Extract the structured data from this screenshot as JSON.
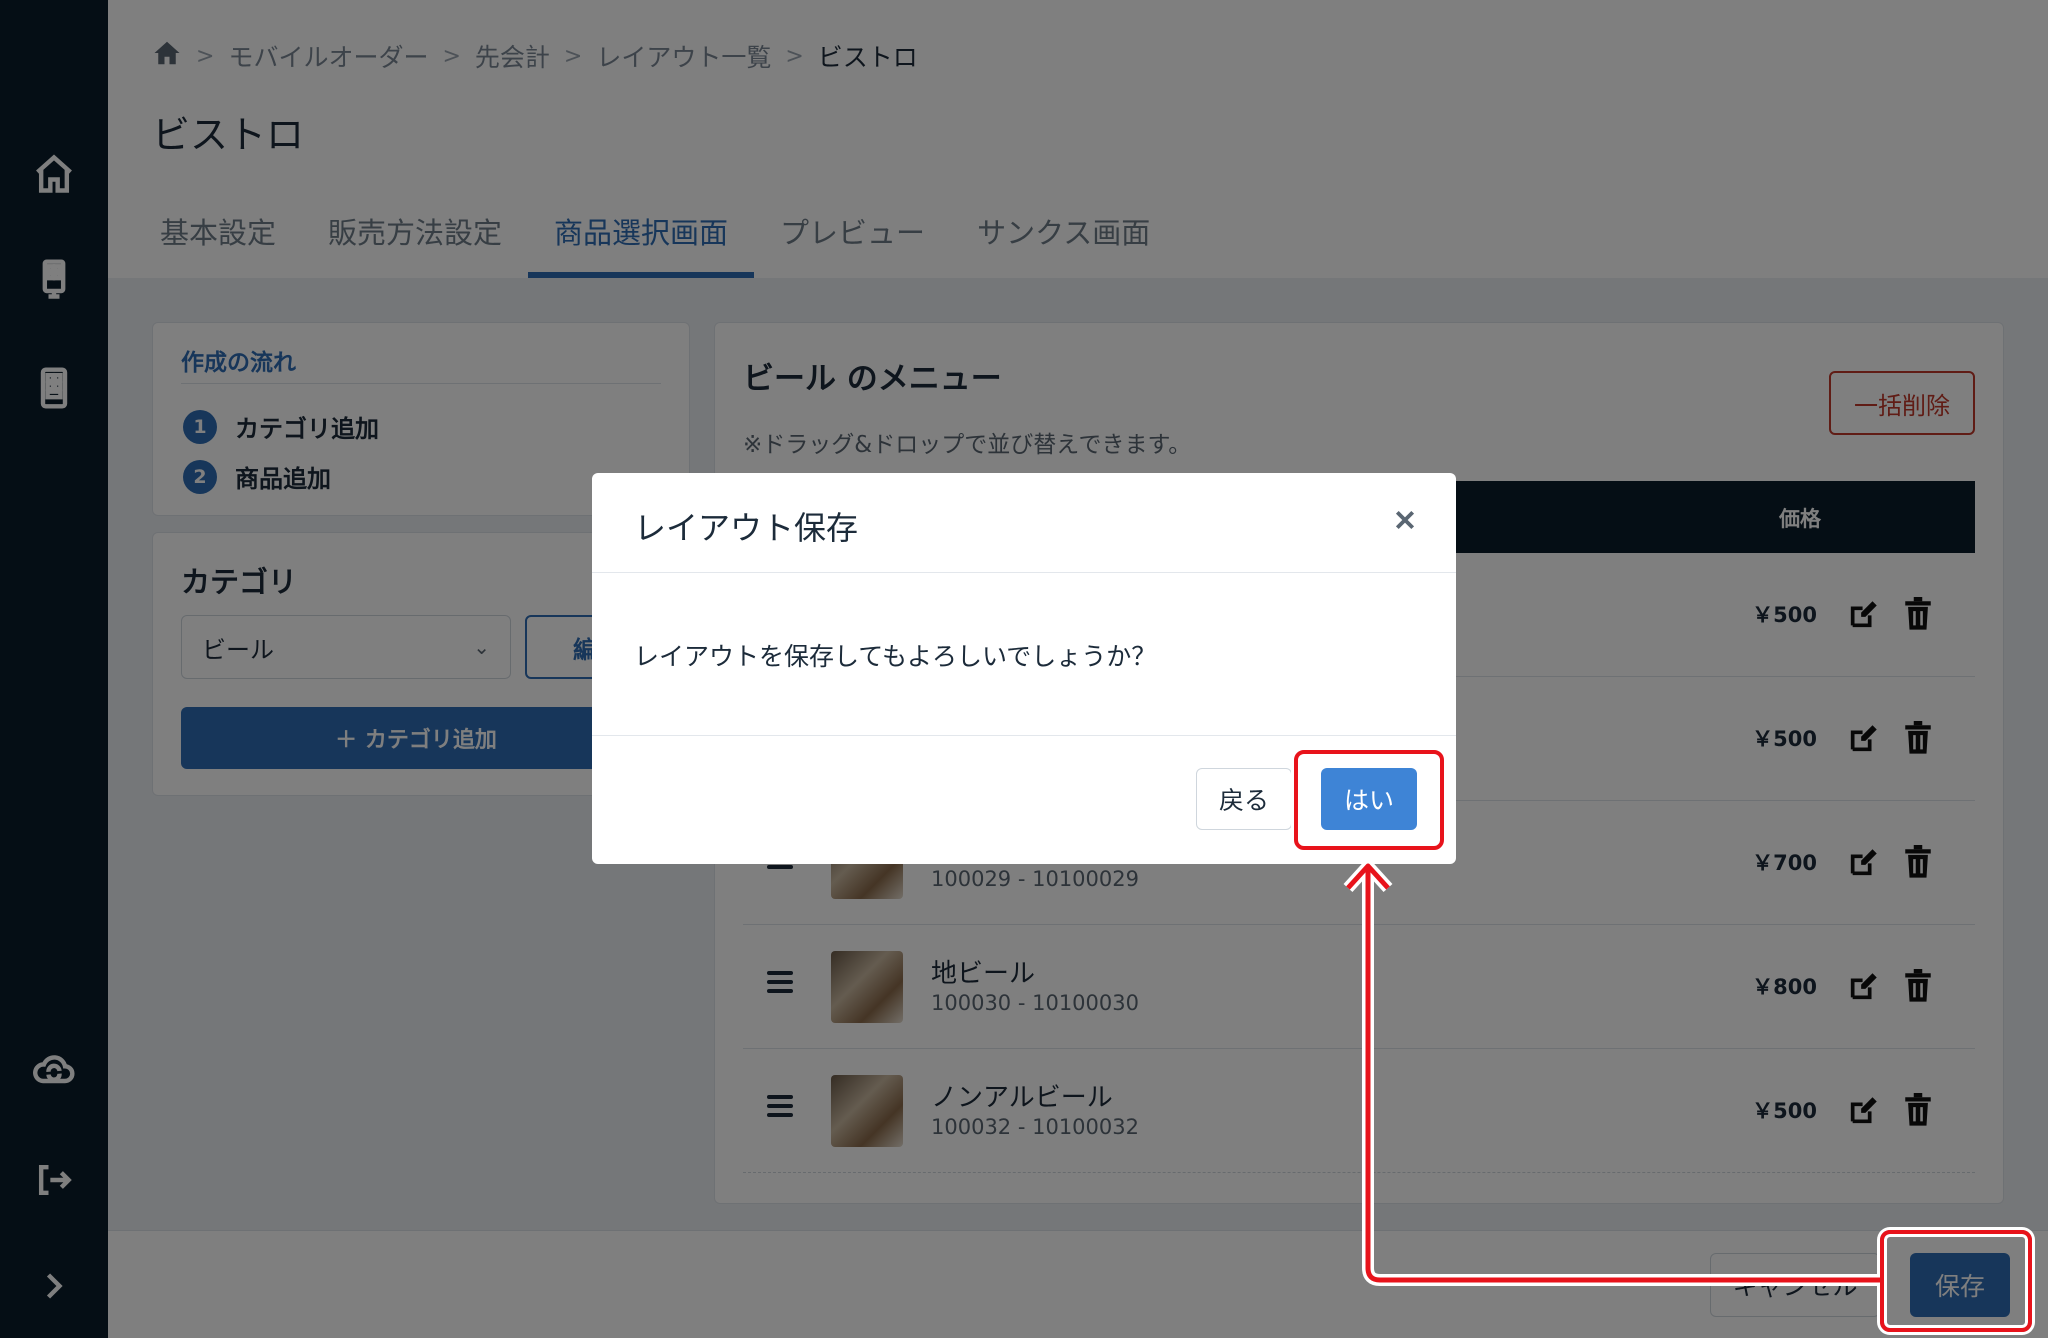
{
  "sidebar": {
    "icons": [
      "home-icon",
      "kiosk-icon",
      "tablet-icon",
      "cloud-sync-icon",
      "logout-icon",
      "expand-icon"
    ]
  },
  "breadcrumb": {
    "items": [
      "モバイルオーダー",
      "先会計",
      "レイアウト一覧"
    ],
    "current": "ビストロ"
  },
  "page": {
    "title": "ビストロ"
  },
  "tabs": [
    {
      "label": "基本設定"
    },
    {
      "label": "販売方法設定"
    },
    {
      "label": "商品選択画面",
      "active": true
    },
    {
      "label": "プレビュー"
    },
    {
      "label": "サンクス画面"
    }
  ],
  "flow": {
    "title": "作成の流れ",
    "steps": [
      {
        "num": "1",
        "label": "カテゴリ追加"
      },
      {
        "num": "2",
        "label": "商品追加"
      }
    ]
  },
  "category": {
    "title": "カテゴリ",
    "selected": "ビール",
    "edit_label": "編",
    "add_label": "＋ カテゴリ追加"
  },
  "menu": {
    "title": "ビール のメニュー",
    "note": "※ドラッグ&ドロップで並び替えできます。",
    "bulk_delete": "一括削除",
    "price_header": "価格",
    "rows": [
      {
        "name": "",
        "code": "",
        "price": "￥500"
      },
      {
        "name": "",
        "code": "",
        "price": "￥500"
      },
      {
        "name": "",
        "code": "100029 - 10100029",
        "price": "￥700"
      },
      {
        "name": "地ビール",
        "code": "100030 - 10100030",
        "price": "￥800"
      },
      {
        "name": "ノンアルビール",
        "code": "100032 - 10100032",
        "price": "￥500"
      }
    ]
  },
  "footer": {
    "cancel_label": "キャンセル",
    "save_label": "保存"
  },
  "modal": {
    "title": "レイアウト保存",
    "message": "レイアウトを保存してもよろしいでしょうか？",
    "back_label": "戻る",
    "yes_label": "はい"
  },
  "colors": {
    "primary": "#2e6db4",
    "sidebar": "#0b1c2b",
    "danger": "#c0392b",
    "annotation": "#e8131b"
  }
}
